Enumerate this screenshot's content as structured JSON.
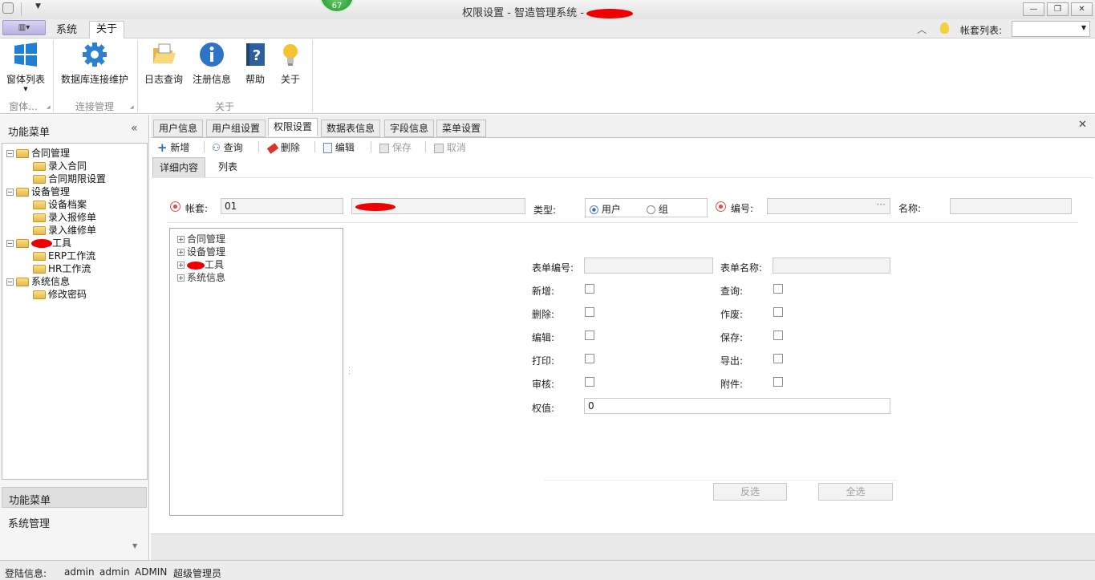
{
  "window": {
    "title": "权限设置 - 智造管理系统 -",
    "badge": "67"
  },
  "menu": {
    "system_tab": "系统",
    "about_tab": "关于",
    "account_list_label": "帐套列表:"
  },
  "ribbon": {
    "buttons": [
      {
        "label": "窗体列表"
      },
      {
        "label": "数据库连接维护"
      },
      {
        "label": "日志查询"
      },
      {
        "label": "注册信息"
      },
      {
        "label": "帮助"
      },
      {
        "label": "关于"
      }
    ],
    "groups": [
      {
        "label": "窗体..."
      },
      {
        "label": "连接管理"
      },
      {
        "label": "关于"
      }
    ]
  },
  "sidebar": {
    "title": "功能菜单",
    "tree": [
      {
        "label": "合同管理"
      },
      {
        "label": "录入合同"
      },
      {
        "label": "合同期限设置"
      },
      {
        "label": "设备管理"
      },
      {
        "label": "设备档案"
      },
      {
        "label": "录入报修单"
      },
      {
        "label": "录入维修单"
      },
      {
        "label": "工具"
      },
      {
        "label": "ERP工作流"
      },
      {
        "label": "HR工作流"
      },
      {
        "label": "系统信息"
      },
      {
        "label": "修改密码"
      }
    ],
    "bottom": [
      {
        "label": "功能菜单"
      },
      {
        "label": "系统管理"
      }
    ]
  },
  "tabs": [
    {
      "label": "用户信息"
    },
    {
      "label": "用户组设置"
    },
    {
      "label": "权限设置"
    },
    {
      "label": "数据表信息"
    },
    {
      "label": "字段信息"
    },
    {
      "label": "菜单设置"
    }
  ],
  "toolbar": [
    {
      "label": "新增"
    },
    {
      "label": "查询"
    },
    {
      "label": "删除"
    },
    {
      "label": "编辑"
    },
    {
      "label": "保存"
    },
    {
      "label": "取消"
    }
  ],
  "subtabs": [
    {
      "label": "详细内容"
    },
    {
      "label": "列表"
    }
  ],
  "form": {
    "account_label": "帐套:",
    "account_value": "01",
    "type_label": "类型:",
    "type_user": "用户",
    "type_group": "组",
    "code_label": "编号:",
    "code_ellipsis": "···",
    "name_label": "名称:"
  },
  "perm_tree": [
    {
      "label": "合同管理"
    },
    {
      "label": "设备管理"
    },
    {
      "label": "工具"
    },
    {
      "label": "系统信息"
    }
  ],
  "perm": {
    "form_code_label": "表单编号:",
    "form_name_label": "表单名称:",
    "add": "新增:",
    "query": "查询:",
    "delete": "删除:",
    "void": "作废:",
    "edit": "编辑:",
    "save": "保存:",
    "print": "打印:",
    "export": "导出:",
    "audit": "审核:",
    "attach": "附件:",
    "weight_label": "权值:",
    "weight_value": "0",
    "invert_button": "反选",
    "select_all_button": "全选"
  },
  "status": {
    "label": "登陆信息:",
    "user1": "admin",
    "user2": "admin",
    "user3": "ADMIN",
    "role": "超级管理员"
  }
}
